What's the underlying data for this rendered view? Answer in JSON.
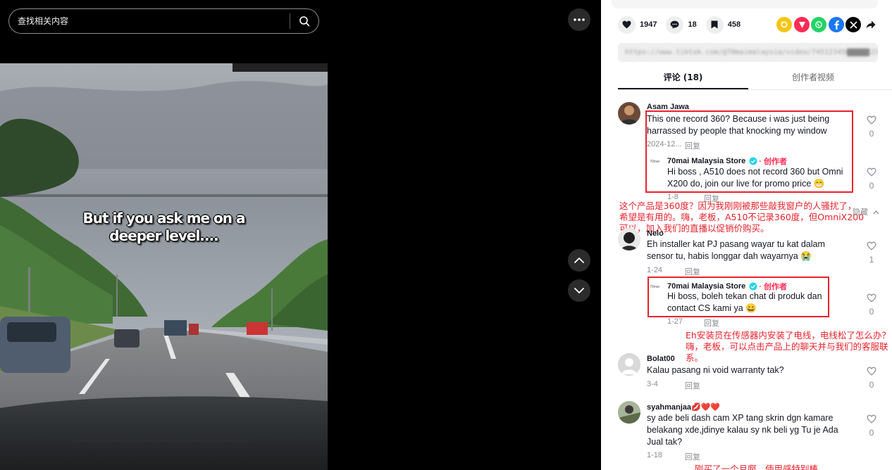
{
  "search": {
    "placeholder": "查找相关内容",
    "icon": "search-icon"
  },
  "video": {
    "caption_line1": "But if you ask me on a",
    "caption_line2": "deeper level...."
  },
  "controls": {
    "more_icon": "more-horizontal-icon",
    "prev_icon": "chevron-up-icon",
    "next_icon": "chevron-down-icon"
  },
  "actions": {
    "likes": "1947",
    "comments": "18",
    "saves": "458"
  },
  "share_icons": [
    "friends-share-icon",
    "send-icon",
    "whatsapp-icon",
    "facebook-icon",
    "x-icon",
    "forward-icon"
  ],
  "url": {
    "text": "https://www.tiktok.com/@70maimalaysia/video/7451234567890123456"
  },
  "tabs": {
    "comments": "评论 (18)",
    "creator_videos": "创作者视频"
  },
  "comments": [
    {
      "user": "Asam Jawa",
      "text": "This one record 360? Because i was just being harrassed by people that knocking my window",
      "date": "2024-12...",
      "reply_label": "回复",
      "likes": "0",
      "reply": {
        "author": "70mai Malaysia Store",
        "badge": "· 创作者",
        "text": "Hi boss , A510 does not record 360 but Omni X200 do, join our live for promo price 😁",
        "date": "1-8",
        "reply_label": "回复",
        "likes": "0"
      }
    },
    {
      "user": "Nelo",
      "text": "Eh installer kat PJ pasang wayar tu kat dalam sensor tu, habis longgar dah wayarnya 😭",
      "date": "1-24",
      "reply_label": "回复",
      "likes": "1",
      "collapse_label": "隐藏",
      "reply": {
        "author": "70mai Malaysia Store",
        "badge": "· 创作者",
        "text": "Hi boss, boleh tekan chat di produk dan contact CS kami ya 😄",
        "date": "1-27",
        "reply_label": "回复",
        "likes": "0"
      }
    },
    {
      "user": "Bolat00",
      "text": "Kalau pasang ni void warranty tak?",
      "date": "3-4",
      "reply_label": "回复",
      "likes": "0"
    },
    {
      "user": "syahmanjaa💋❤️❤️",
      "text": "sy ade beli dash cam XP tang skrin dgn kamare belakang xde,jdinye kalau sy nk beli yg Tu je Ada Jual tak?",
      "date": "1-18",
      "reply_label": "回复",
      "likes": "0"
    }
  ],
  "annotations": {
    "a1": "这个产品是360度？因为我刚刚被那些敲我窗户的人骚扰了，希望是有用的。嗨，老板，A510不记录360度，但OmniX200可以，加入我们的直播以促销价购买。",
    "a2": "Eh安装员在传感器内安装了电线，电线松了怎么办？嗨，老板，可以点击产品上的聊天并与我们的客服联系。",
    "a3": "刚买了一个月啊，使用感特别棒"
  },
  "colors": {
    "accent_red": "#fe2c55",
    "annotation_red": "#e8222c",
    "verified_blue": "#20d5ec"
  }
}
